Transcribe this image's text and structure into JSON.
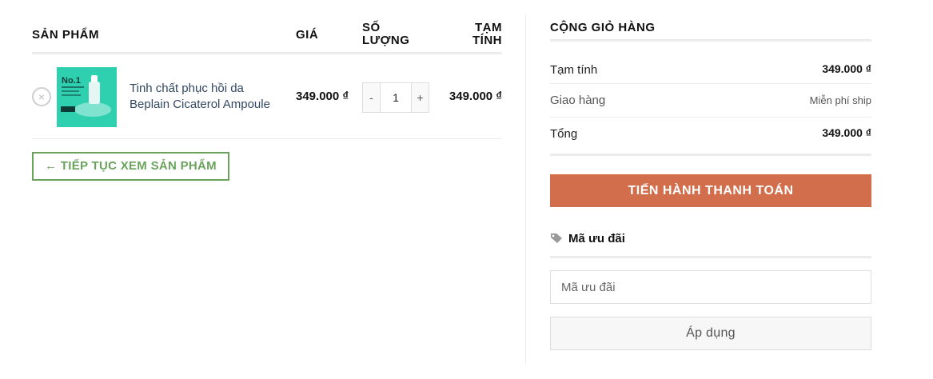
{
  "cart": {
    "headers": {
      "product": "SẢN PHẨM",
      "price": "GIÁ",
      "qty_line1": "SỐ",
      "qty_line2": "LƯỢNG",
      "subtotal_line1": "TẠM",
      "subtotal_line2": "TÍNH"
    },
    "items": [
      {
        "remove_icon": "×",
        "image_text": "No.1",
        "name_line1": "Tinh chất phục hồi da",
        "name_line2": "Beplain Cicaterol Ampoule",
        "price": "349.000 ₫",
        "qty_minus": "-",
        "qty": "1",
        "qty_plus": "+",
        "subtotal": "349.000 ₫"
      }
    ],
    "continue_label": "← TIẾP TỤC XEM SẢN PHẨM"
  },
  "totals": {
    "title": "CỘNG GIỎ HÀNG",
    "subtotal_label": "Tạm tính",
    "subtotal_value": "349.000 ₫",
    "shipping_label": "Giao hàng",
    "shipping_value": "Miễn phí ship",
    "total_label": "Tổng",
    "total_value": "349.000 ₫",
    "checkout_label": "TIẾN HÀNH THANH TOÁN"
  },
  "coupon": {
    "icon": "tag-icon",
    "label": "Mã ưu đãi",
    "placeholder": "Mã ưu đãi",
    "apply_label": "Áp dụng"
  },
  "colors": {
    "checkout": "#d26e4b",
    "continue": "#6aa35b",
    "product_link": "#334862"
  }
}
